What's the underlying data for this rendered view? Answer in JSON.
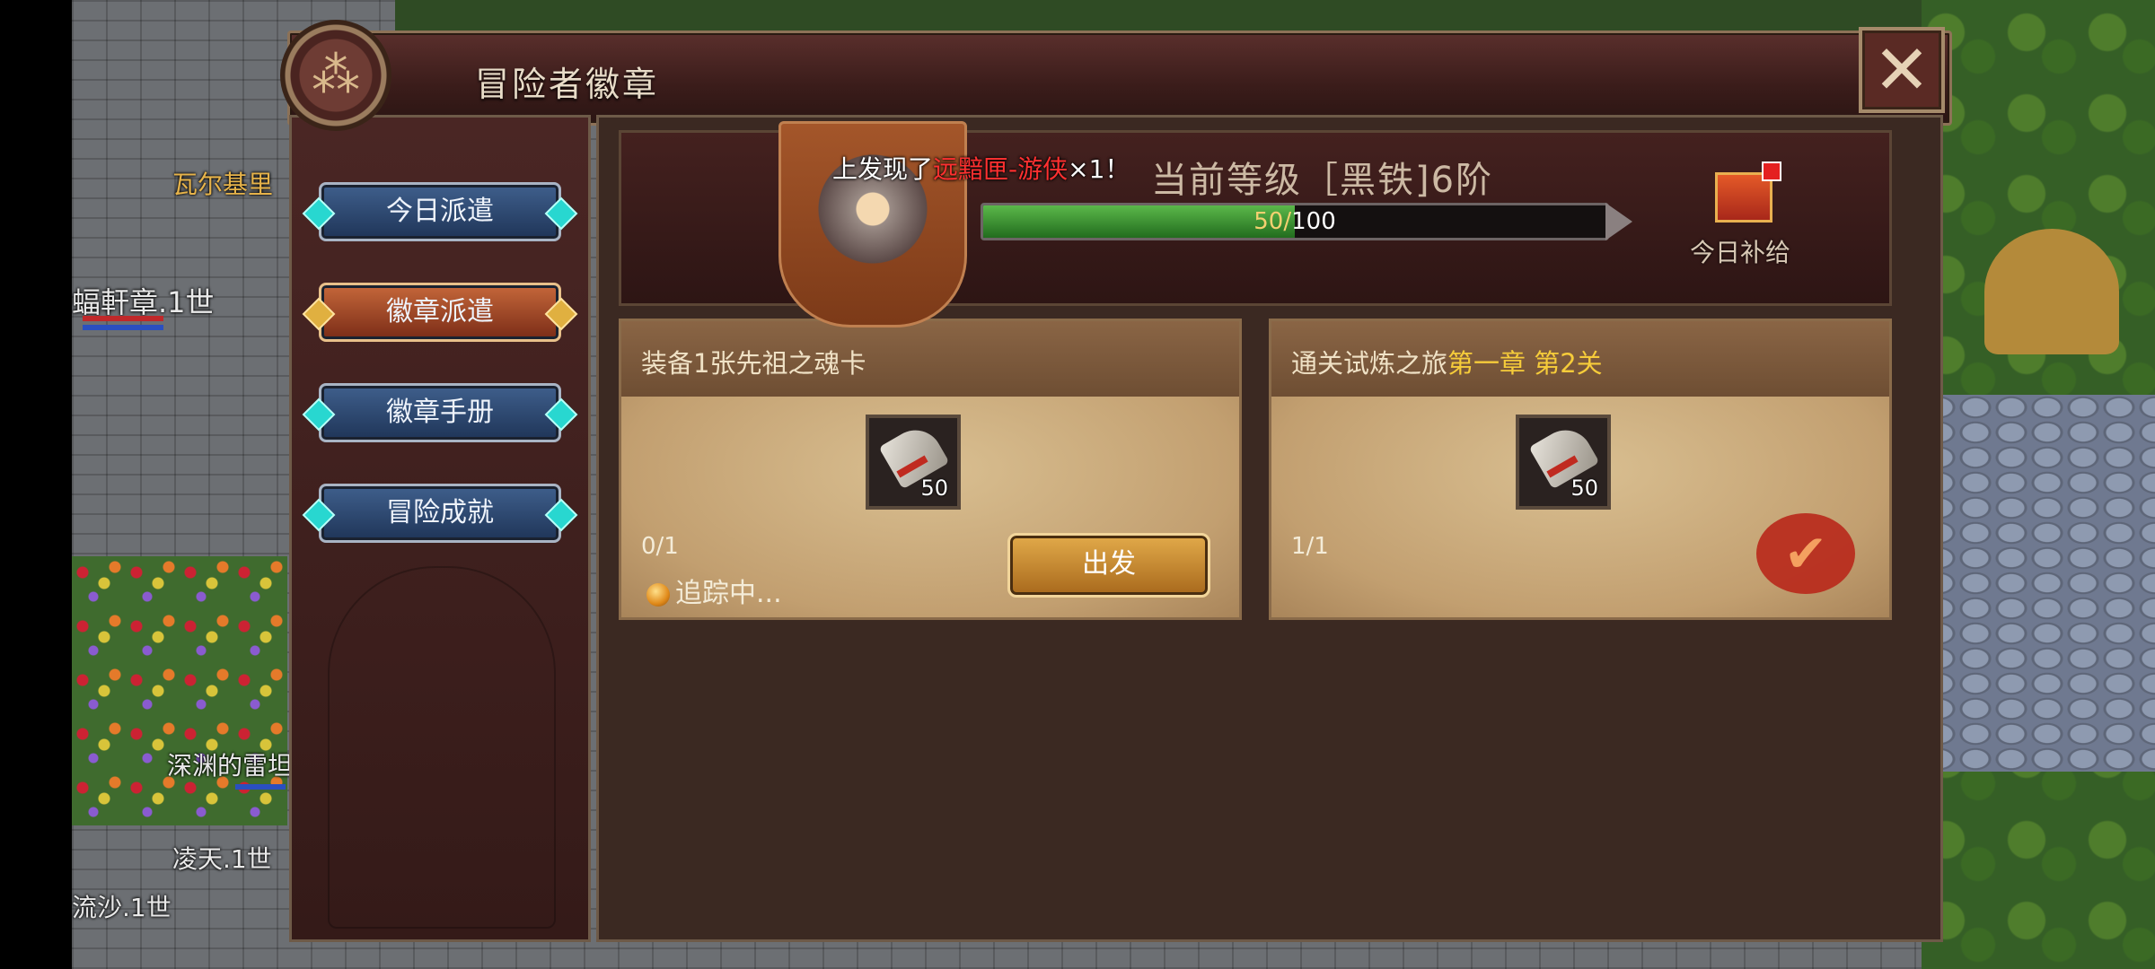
{
  "world": {
    "npc_name": "瓦尔基里",
    "player_label": "蝠軒章.1世",
    "tile_label": "深渊的雷坦",
    "name_1": "凌天.1世",
    "name_2": "流沙.1世"
  },
  "panel": {
    "title": "冒险者徽章",
    "emblem_glyph": "⁂",
    "close_glyph": "✕"
  },
  "sidebar": {
    "items": [
      {
        "label": "今日派遣",
        "active": false
      },
      {
        "label": "徽章派遣",
        "active": true
      },
      {
        "label": "徽章手册",
        "active": false
      },
      {
        "label": "冒险成就",
        "active": false
      }
    ]
  },
  "notice": {
    "prefix": "上发现了",
    "item": "远黯匣-游侠",
    "suffix": "×1！"
  },
  "level": {
    "text": "当前等级［黑铁]6阶",
    "xp_current": "50",
    "xp_sep": "/",
    "xp_max": "100",
    "xp_fraction": 0.5
  },
  "gift": {
    "label": "今日补给"
  },
  "missions": [
    {
      "title": "装备1张先祖之魂卡",
      "title_hl": "",
      "item_qty": "50",
      "progress": "0/1",
      "status": "追踪中...",
      "button": "出发"
    },
    {
      "title": "通关试炼之旅",
      "title_hl": "第一章 第2关",
      "item_qty": "50",
      "progress": "1/1",
      "completed": true
    }
  ],
  "colors": {
    "highlight": "#f6cc3a",
    "notice_red": "#ff3030",
    "xp_green": "#3c9a34"
  }
}
